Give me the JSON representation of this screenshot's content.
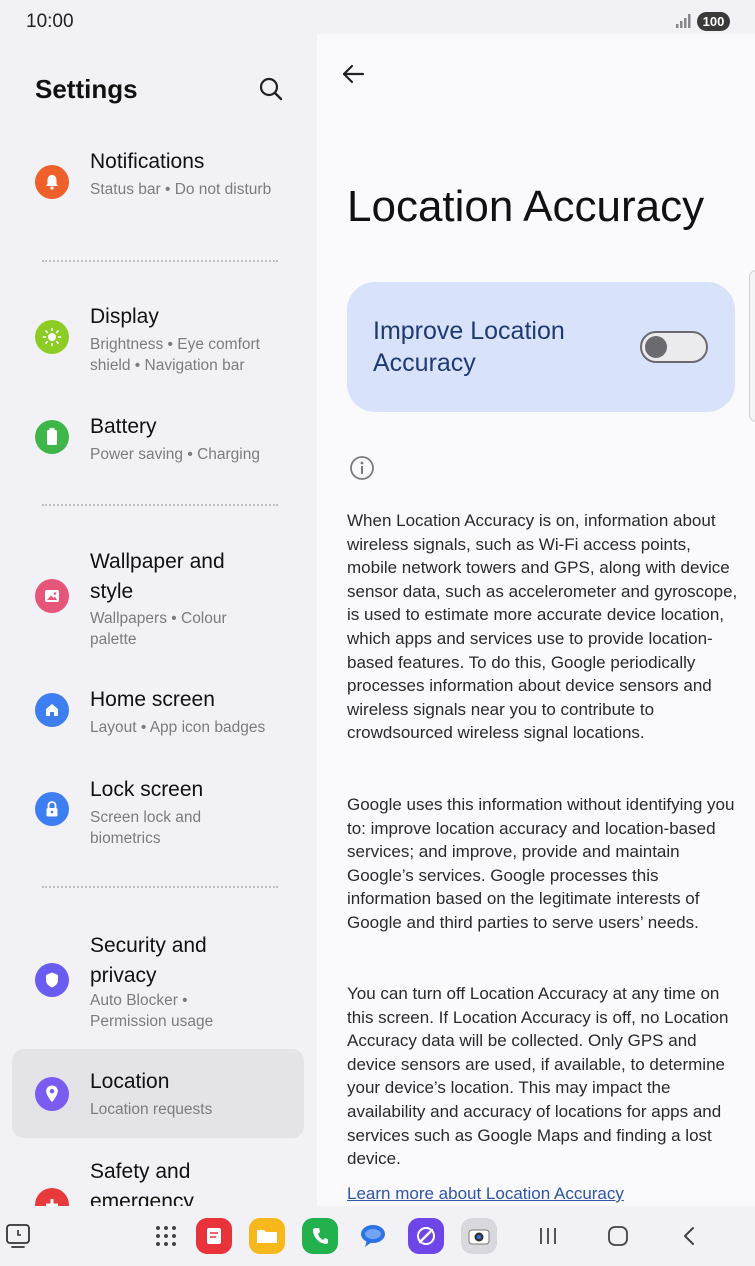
{
  "status_bar": {
    "time": "10:00",
    "battery": "100"
  },
  "settings": {
    "title": "Settings",
    "items": [
      {
        "title": "Notifications",
        "sub": "Status bar  •  Do not disturb"
      },
      {
        "title": "Display",
        "sub": "Brightness  •  Eye comfort shield  •  Navigation bar"
      },
      {
        "title": "Battery",
        "sub": "Power saving  •  Charging"
      },
      {
        "title": "Wallpaper and style",
        "sub": "Wallpapers  •  Colour palette"
      },
      {
        "title": "Home screen",
        "sub": "Layout  •  App icon badges"
      },
      {
        "title": "Lock screen",
        "sub": "Screen lock and biometrics"
      },
      {
        "title": "Security and privacy",
        "sub": "Auto Blocker  •  Permission usage"
      },
      {
        "title": "Location",
        "sub": "Location requests"
      },
      {
        "title": "Safety and emergency",
        "sub": ""
      }
    ]
  },
  "detail": {
    "title": "Location Accuracy",
    "toggle_label": "Improve Location Accuracy",
    "toggle_on": false,
    "paragraphs": [
      "When Location Accuracy is on, information about wireless signals, such as Wi-Fi access points, mobile network towers and GPS, along with device sensor data, such as accelerometer and gyroscope, is used to estimate more accurate device location, which apps and services use to provide location-based features. To do this, Google periodically processes information about device sensors and wireless signals near you to contribute to crowdsourced wireless signal locations.",
      "Google uses this information without identifying you to: improve location accuracy and location-based services; and improve, provide and maintain Google’s services. Google processes this information based on the legitimate interests of Google and third parties to serve users’ needs.",
      "You can turn off Location Accuracy at any time on this screen. If Location Accuracy is off, no Location Accuracy data will be collected. Only GPS and device sensors are used, if available, to determine your device’s location. This may impact the availability and accuracy of locations for apps and services such as Google Maps and finding a lost device."
    ],
    "learn_more": "Learn more about Location Accuracy"
  },
  "colors": {
    "notifications": "#f0602a",
    "display": "#8ccc24",
    "battery": "#3fb64a",
    "wallpaper": "#e8557a",
    "home": "#3d7ef0",
    "lock": "#3d7ef0",
    "security": "#6a5cf0",
    "location": "#7a5cf0",
    "safety": "#e83a3a"
  }
}
